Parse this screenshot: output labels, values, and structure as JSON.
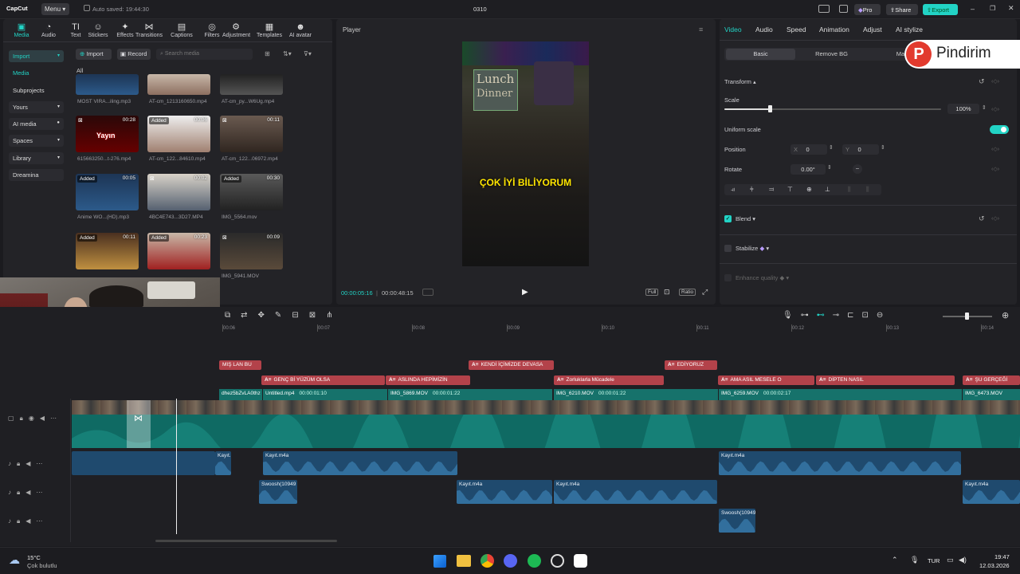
{
  "titlebar": {
    "logo": "CapCut",
    "menu": "Menu",
    "autosave": "Auto saved: 19:44:30",
    "project": "0310",
    "pro": "Pro",
    "share": "Share",
    "export": "Export"
  },
  "toolbar": [
    {
      "label": "Media",
      "icon": "media-icon"
    },
    {
      "label": "Audio",
      "icon": "audio-icon"
    },
    {
      "label": "Text",
      "icon": "text-icon"
    },
    {
      "label": "Stickers",
      "icon": "stickers-icon"
    },
    {
      "label": "Effects",
      "icon": "effects-icon"
    },
    {
      "label": "Transitions",
      "icon": "transitions-icon"
    },
    {
      "label": "Captions",
      "icon": "captions-icon"
    },
    {
      "label": "Filters",
      "icon": "filters-icon"
    },
    {
      "label": "Adjustment",
      "icon": "adjustment-icon"
    },
    {
      "label": "Templates",
      "icon": "templates-icon"
    },
    {
      "label": "AI avatar",
      "icon": "ai-avatar-icon"
    }
  ],
  "sidebar": [
    {
      "label": "Import"
    },
    {
      "label": "Media"
    },
    {
      "label": "Subprojects"
    },
    {
      "label": "Yours"
    },
    {
      "label": "AI media"
    },
    {
      "label": "Spaces"
    },
    {
      "label": "Library"
    },
    {
      "label": "Dreamina"
    }
  ],
  "media_bar": {
    "import": "Import",
    "record": "Record",
    "search_placeholder": "Search media",
    "all": "All"
  },
  "media": [
    {
      "name": "MOST VIRA...iling.mp3",
      "dur": "",
      "added": ""
    },
    {
      "name": "AT-cm_1213160650.mp4",
      "dur": "",
      "added": ""
    },
    {
      "name": "AT-cm_py...W6Ug.mp4",
      "dur": "",
      "added": ""
    },
    {
      "name": "615663250...t-276.mp4",
      "dur": "00:28",
      "added": "",
      "overlay": "Yayın"
    },
    {
      "name": "AT-cm_122...84610.mp4",
      "dur": "00:06",
      "added": "Added"
    },
    {
      "name": "AT-cm_122...06972.mp4",
      "dur": "00:11",
      "added": ""
    },
    {
      "name": "Anime WO...(HD).mp3",
      "dur": "00:05",
      "added": "Added"
    },
    {
      "name": "4BC4E743...3D27.MP4",
      "dur": "00:02",
      "added": ""
    },
    {
      "name": "IMG_5564.mov",
      "dur": "00:30",
      "added": "Added"
    },
    {
      "name": "",
      "dur": "00:11",
      "added": "Added"
    },
    {
      "name": "",
      "dur": "00:23",
      "added": "Added"
    },
    {
      "name": "IMG_5941.MOV",
      "dur": "00:09",
      "added": ""
    }
  ],
  "player": {
    "title": "Player",
    "caption": "ÇOK İYİ BİLİYORUM",
    "sign1": "Lunch",
    "sign2": "Dinner",
    "current": "00:00:05:16",
    "total": "00:00:48:15",
    "full": "Full",
    "ratio": "Ratio"
  },
  "inspector": {
    "tabs": [
      "Video",
      "Audio",
      "Speed",
      "Animation",
      "Adjust",
      "AI stylize"
    ],
    "subtabs": [
      "Basic",
      "Remove BG",
      "Ma"
    ],
    "watermark": "Pindirim",
    "transform": "Transform",
    "scale": "Scale",
    "scale_val": "100%",
    "scale_level": 0.3,
    "uniform": "Uniform scale",
    "position": "Position",
    "pos_x_lbl": "X",
    "pos_x": "0",
    "pos_y_lbl": "Y",
    "pos_y": "0",
    "rotate": "Rotate",
    "rotate_val": "0.00°",
    "blend": "Blend",
    "stabilize": "Stabilize",
    "enhance": "Enhance quality"
  },
  "ruler": [
    "00:06",
    "00:07",
    "00:08",
    "00:09",
    "00:10",
    "00:11",
    "00:12",
    "00:13",
    "00:14"
  ],
  "captions_row1": [
    {
      "t": "MIŞ LAN BU"
    },
    {
      "t": "KENDİ İÇİMİZDE DEVASA"
    },
    {
      "t": "EDİYORUZ"
    }
  ],
  "captions_row2": [
    {
      "t": "GENÇ Bİ YÜZÜM OLSA"
    },
    {
      "t": "ASLINDA HEPİMİZİN"
    },
    {
      "t": "Zorluklarla Mücadele"
    },
    {
      "t": "AMA ASIL MESELE O"
    },
    {
      "t": "DİPTEN NASIL"
    },
    {
      "t": "ŞU GERÇEĞİ"
    }
  ],
  "video_clips": [
    {
      "name": "dhez5bZvLA0thz"
    },
    {
      "name": "Untitled.mp4",
      "dur": "00:00:01:10"
    },
    {
      "name": "IMG_5869.MOV",
      "dur": "00:00:01:22"
    },
    {
      "name": "IMG_6210.MOV",
      "dur": "00:00:01:22"
    },
    {
      "name": "IMG_6259.MOV",
      "dur": "00:00:02:17"
    },
    {
      "name": "IMG_6473.MOV"
    }
  ],
  "audio1": [
    {
      "name": "Kayıt."
    },
    {
      "name": "Kayıt.m4a"
    },
    {
      "name": "Kayıt.m4a"
    }
  ],
  "audio2": [
    {
      "name": "Swoosh(10949"
    },
    {
      "name": "Kayıt.m4a"
    },
    {
      "name": "Kayıt.m4a"
    },
    {
      "name": "Kayıt.m4a"
    }
  ],
  "audio3": [
    {
      "name": "Swoosh(10949"
    }
  ],
  "taskbar": {
    "temp": "15°C",
    "weather": "Çok bulutlu",
    "lang": "TUR",
    "time": "19:47",
    "date": "12.03.2026"
  },
  "colors": {
    "accent": "#22d3c5",
    "caption": "#b3424a",
    "video": "#16726b",
    "audio": "#1f4a6e"
  }
}
